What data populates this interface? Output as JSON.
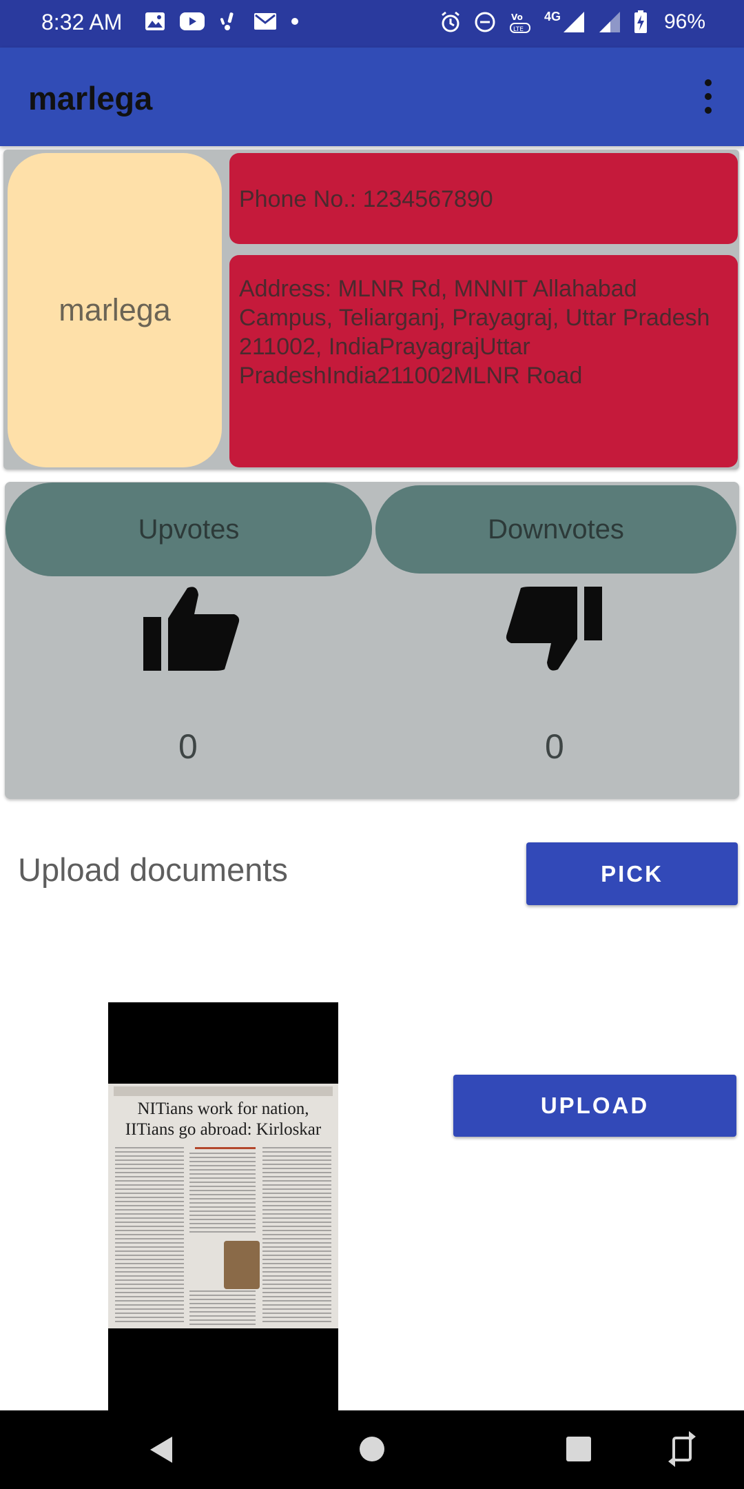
{
  "status_bar": {
    "time": "8:32 AM",
    "network": "4G",
    "battery": "96%",
    "icons_left": [
      "gallery-icon",
      "youtube-icon",
      "notification-icon",
      "gmail-icon",
      "dot-icon"
    ],
    "icons_right": [
      "alarm-icon",
      "dnd-icon",
      "volte-icon",
      "signal-icon",
      "signal-weak-icon",
      "battery-charging-icon"
    ]
  },
  "app_bar": {
    "title": "marlega"
  },
  "profile": {
    "name": "marlega",
    "phone": "Phone No.: 1234567890",
    "address": "Address: MLNR Rd, MNNIT Allahabad Campus, Teliarganj, Prayagraj, Uttar Pradesh 211002, IndiaPrayagrajUttar PradeshIndia211002MLNR Road"
  },
  "votes": {
    "upvotes_label": "Upvotes",
    "downvotes_label": "Downvotes",
    "upvotes_count": "0",
    "downvotes_count": "0"
  },
  "upload": {
    "label": "Upload documents",
    "pick_label": "PICK",
    "upload_label": "UPLOAD"
  },
  "document_preview": {
    "headline": "NITians work for nation, IITians go abroad: Kirloskar"
  },
  "colors": {
    "app_bar": "#314cb6",
    "status_bar": "#2a3a9e",
    "name_pill": "#fee0a9",
    "info_box": "#c51a3b",
    "vote_pill": "#5a7c79",
    "card_bg": "#b9bdbe",
    "button": "#3249b8"
  }
}
